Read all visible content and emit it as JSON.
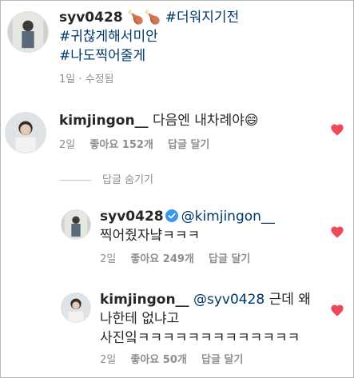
{
  "caption": {
    "username": "syv0428",
    "emoji": "🍗🍗",
    "hashtag_1": "#더워지기전",
    "hashtag_2": "#귀찮게해서미안",
    "hashtag_3": "#나도찍어줄게",
    "time": "1일",
    "edited": "· 수정됨"
  },
  "comments": [
    {
      "username": "kimjingon__",
      "text": "다음엔 내차례야😄",
      "time": "2일",
      "likes": "좋아요 152개",
      "reply_label": "답글 달기"
    }
  ],
  "hide_replies_label": "답글 숨기기",
  "replies": [
    {
      "username": "syv0428",
      "mention": "@kimjingon__",
      "text": "찍어줬자냨ㅋㅋㅋ",
      "time": "2일",
      "likes": "좋아요 249개",
      "reply_label": "답글 달기"
    },
    {
      "username": "kimjingon__",
      "mention": "@syv0428",
      "text_1": "근데 왜",
      "text_2": "나한테 없냐고",
      "text_3": "사진잌ㅋㅋㅋㅋㅋㅋㅋㅋㅋㅋㅋㅋㅋ",
      "time": "2일",
      "likes": "좋아요 50개",
      "reply_label": "답글 달기"
    }
  ],
  "colors": {
    "heart": "#ed4956",
    "verified": "#3897f0",
    "mention": "#00376b",
    "meta": "#8e8e8e"
  },
  "icons": {
    "like": "heart-icon",
    "verified": "verified-badge-icon"
  }
}
